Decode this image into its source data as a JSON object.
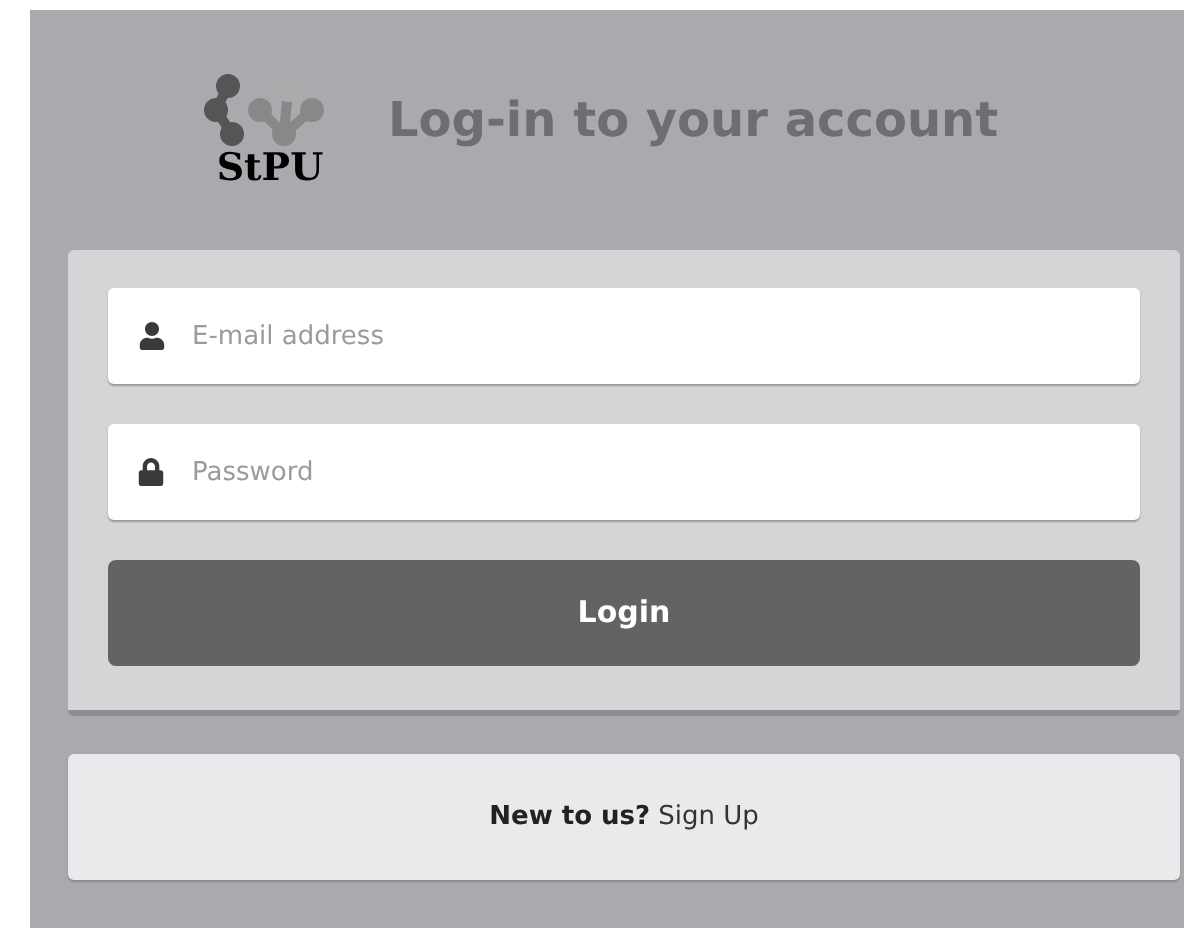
{
  "header": {
    "logo_text": "StPU",
    "title": "Log-in to your account"
  },
  "form": {
    "fields": [
      {
        "kind": "email",
        "placeholder": "E-mail address"
      },
      {
        "kind": "password",
        "placeholder": "Password"
      }
    ],
    "submit": "Login"
  },
  "signup": {
    "prompt": "New to us?",
    "link": "Sign Up"
  }
}
